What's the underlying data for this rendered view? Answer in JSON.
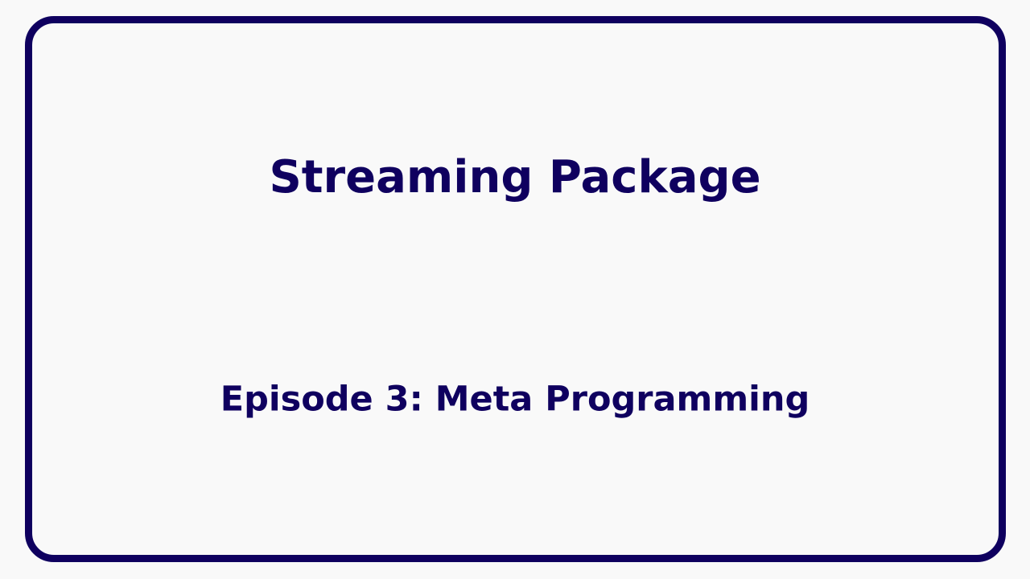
{
  "slide": {
    "title": "Streaming Package",
    "subtitle": "Episode 3: Meta Programming"
  },
  "colors": {
    "accent": "#0f005f",
    "background": "#f9f9f9"
  }
}
